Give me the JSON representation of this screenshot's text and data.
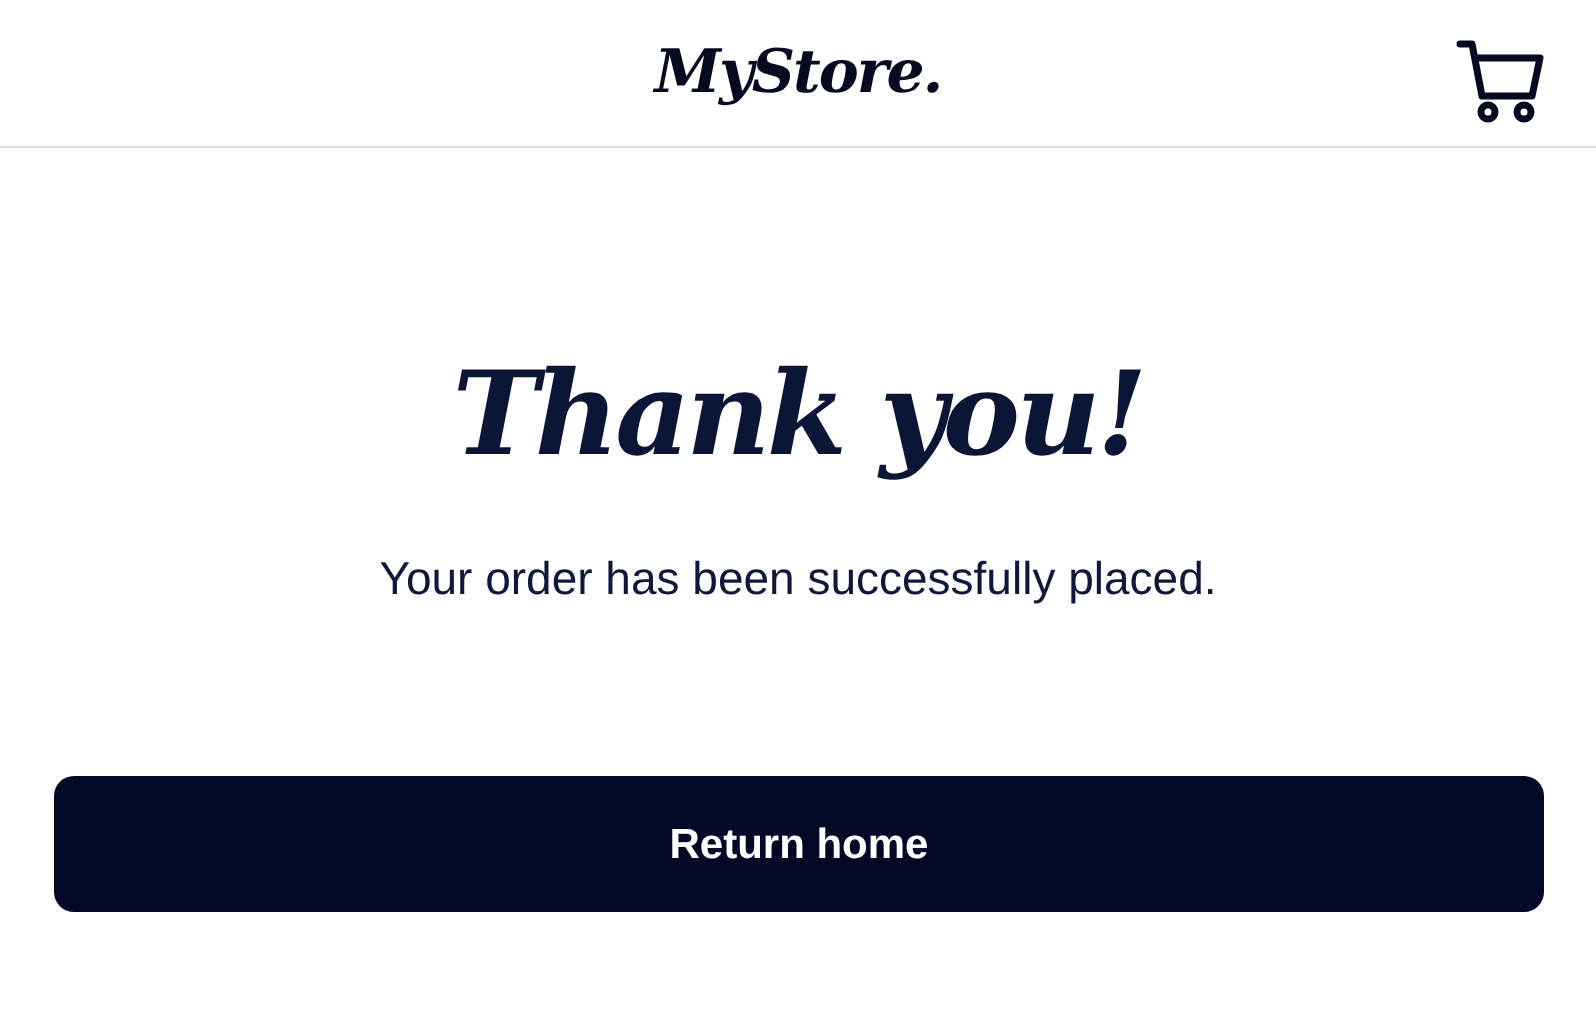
{
  "header": {
    "logo": "MyStore."
  },
  "title": "Thank you!",
  "message": "Your order has been successfully placed.",
  "button": "Return home"
}
